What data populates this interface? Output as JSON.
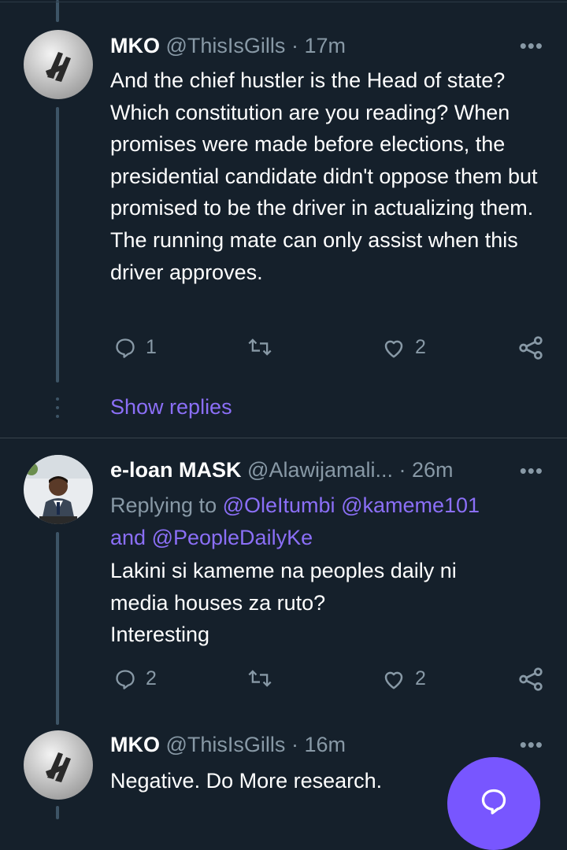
{
  "tweets": [
    {
      "name": "MKO",
      "handle": "@ThisIsGills",
      "time": "· 17m",
      "more": "•••",
      "text": "And the chief hustler is the Head of state? Which constitution are you reading? When promises were made before elections, the presidential candidate didn't oppose them but promised to be the driver in actualizing them. The running mate can only assist when this driver approves.",
      "replies": "1",
      "retweets": "",
      "likes": "2",
      "show_replies": "Show replies"
    },
    {
      "name": "e-loan MASK",
      "handle": "@Alawijamali...",
      "time": "· 26m",
      "more": "•••",
      "replying_prefix": "Replying to",
      "mention_1": "@OleItumbi",
      "mention_2": "@kameme101",
      "and": "and",
      "mention_3": "@PeopleDailyKe",
      "text_line_1": "Lakini si kameme na peoples daily ni",
      "text_line_2": "media houses za ruto?",
      "text_line_3": "Interesting",
      "replies": "2",
      "retweets": "",
      "likes": "2"
    },
    {
      "name": "MKO",
      "handle": "@ThisIsGills",
      "time": "· 16m",
      "more": "•••",
      "text": "Negative. Do More research."
    }
  ],
  "icons": {
    "reply": "reply-icon",
    "retweet": "retweet-icon",
    "like": "heart-icon",
    "share": "share-icon",
    "compose": "compose-reply-icon"
  },
  "colors": {
    "background": "#15202b",
    "accent": "#7856ff",
    "link": "#8b6ff7",
    "secondary_text": "#8899a6",
    "thread_line": "#3d5466"
  }
}
